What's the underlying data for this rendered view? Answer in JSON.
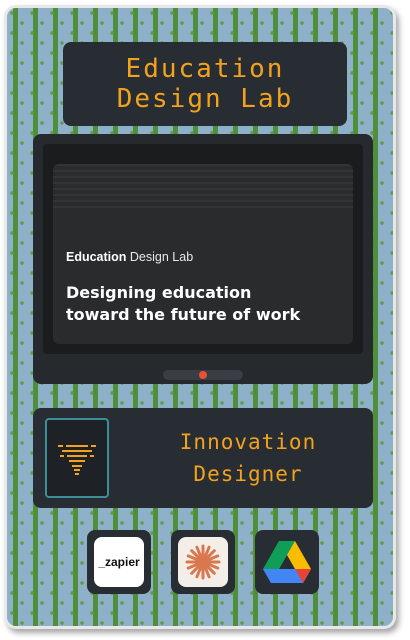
{
  "header": {
    "title_line1": "Education",
    "title_line2": "Design Lab"
  },
  "screen": {
    "brand_bold": "Education",
    "brand_rest": "Design Lab",
    "headline_line1": "Designing education",
    "headline_line2": "toward the future of work"
  },
  "role": {
    "line1": "Innovation",
    "line2": "Designer"
  },
  "tools": {
    "zapier_label": "_zapier"
  },
  "colors": {
    "accent": "#f2a21c",
    "background": "#8fb0c9",
    "panel": "#282d33",
    "led": "#e8512f",
    "icon_border": "#3b8f98"
  }
}
